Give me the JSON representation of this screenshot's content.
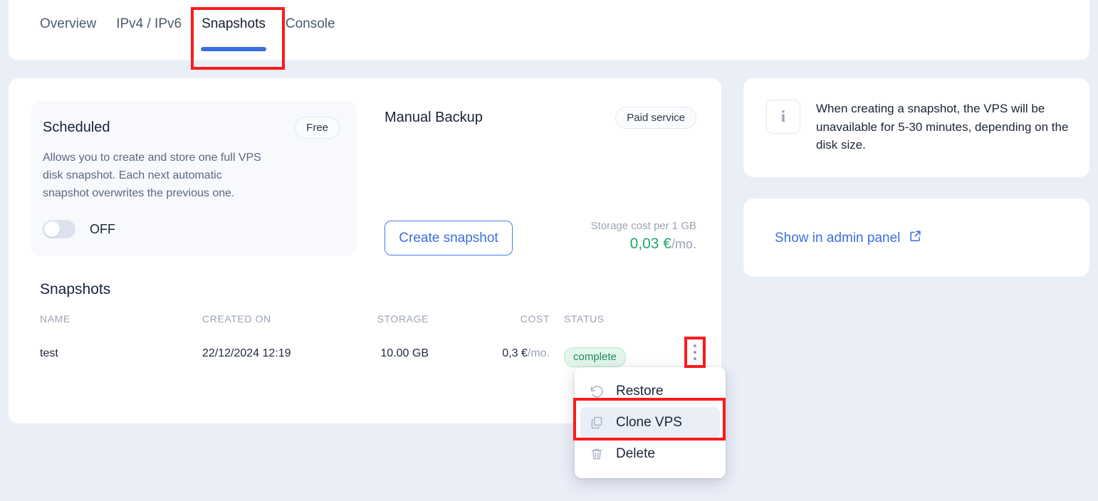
{
  "tabs": [
    {
      "label": "Overview",
      "active": false
    },
    {
      "label": "IPv4 / IPv6",
      "active": false
    },
    {
      "label": "Snapshots",
      "active": true
    },
    {
      "label": "Console",
      "active": false
    }
  ],
  "scheduled": {
    "title": "Scheduled",
    "badge": "Free",
    "description": "Allows you to create and store one full VPS disk snapshot. Each next automatic snapshot overwrites the previous one.",
    "toggle_state": "OFF"
  },
  "manual_backup": {
    "title": "Manual Backup",
    "badge": "Paid service",
    "create_button": "Create snapshot",
    "cost_label": "Storage cost per 1 GB",
    "cost_value": "0,03 €",
    "cost_suffix": "/mo."
  },
  "snapshots": {
    "section_title": "Snapshots",
    "columns": [
      "NAME",
      "CREATED ON",
      "STORAGE",
      "COST",
      "STATUS"
    ],
    "rows": [
      {
        "name": "test",
        "created_on": "22/12/2024 12:19",
        "storage": "10.00 GB",
        "cost_value": "0,3 €",
        "cost_suffix": "/mo.",
        "status": "complete"
      }
    ]
  },
  "row_menu": {
    "items": [
      {
        "label": "Restore",
        "icon": "restore-icon",
        "highlighted": false
      },
      {
        "label": "Clone VPS",
        "icon": "clone-icon",
        "highlighted": true
      },
      {
        "label": "Delete",
        "icon": "trash-icon",
        "highlighted": false
      }
    ]
  },
  "sidebar": {
    "info_text": "When creating a snapshot, the VPS will be unavailable for 5-30 minutes, depending on the disk size.",
    "info_icon_glyph": "i",
    "admin_link": "Show in admin panel"
  },
  "colors": {
    "accent_blue": "#3b6fe0",
    "page_bg": "#eaeef7",
    "success_green": "#1fa968",
    "highlight_red": "#fb1b1b",
    "badge_green_text": "#1f8a5e",
    "badge_green_bg": "#e3f6ec"
  }
}
